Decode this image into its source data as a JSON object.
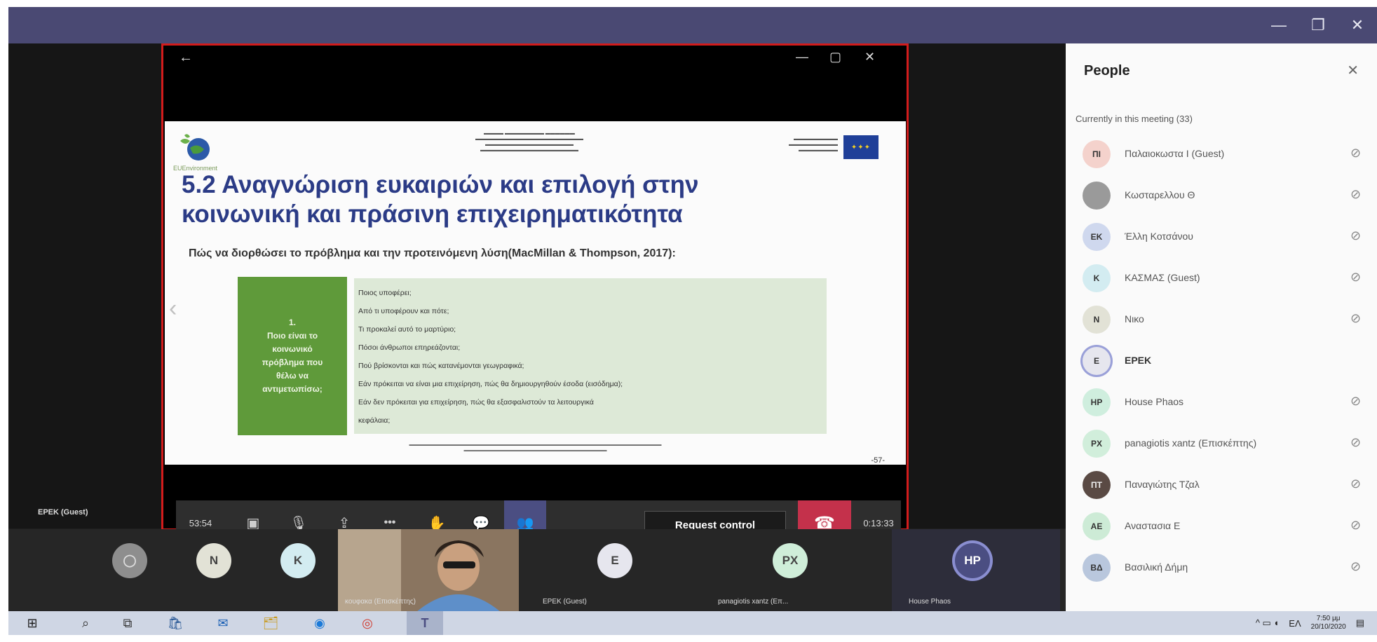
{
  "window": {
    "controls": {
      "minimize": "—",
      "restore": "❐",
      "close": "✕"
    }
  },
  "share": {
    "back_glyph": "←",
    "minimize_glyph": "—",
    "restore_glyph": "▢",
    "close_glyph": "✕",
    "prev_glyph": "‹"
  },
  "slide": {
    "logo_caption": "EUEnvironment",
    "title": "5.2 Αναγνώριση ευκαιριών και επιλογή στην κοινωνική και πράσινη επιχειρηματικότητα",
    "subtitle": "Πώς να διορθώσει το πρόβλημα και την προτεινόμενη λύση(MacMillan & Thompson, 2017):",
    "green_box": {
      "num": "1.",
      "lines": [
        "Ποιο είναι το",
        "κοινωνικό",
        "πρόβλημα που",
        "θέλω να",
        "αντιμετωπίσω;"
      ]
    },
    "questions": [
      "Ποιος υποφέρει;",
      "Από τι υποφέρουν και πότε;",
      "Τι προκαλεί αυτό το μαρτύριο;",
      "Πόσοι άνθρωποι επηρεάζονται;",
      "Πού βρίσκονται και πώς κατανέμονται γεωγραφικά;",
      "Εάν πρόκειται να είναι μια επιχείρηση, πώς θα δημιουργηθούν έσοδα (εισόδημα);",
      "Εάν δεν πρόκειται για επιχείρηση, πώς θα εξασφαλιστούν τα λειτουργικά",
      "κεφάλαια;"
    ],
    "page_number": "-57-"
  },
  "controls": {
    "time": "53:54",
    "camera_icon": "▣",
    "mic_icon": "🎙",
    "share_icon": "⇪",
    "more_icon": "•••",
    "hand_icon": "✋",
    "chat_icon": "💬",
    "people_icon": "👥",
    "request_control": "Request control",
    "hangup_icon": "☎",
    "elapsed": "0:13:33"
  },
  "stage_label": "EPEK (Guest)",
  "strip": {
    "tiles": [
      {
        "initials": "",
        "name": ""
      },
      {
        "initials": "N",
        "name": ""
      },
      {
        "initials": "K",
        "name": ""
      },
      {
        "initials": "",
        "name": "κουφακα (Επισκέπτης)"
      },
      {
        "initials": "E",
        "name": "EPEK (Guest)"
      },
      {
        "initials": "PX",
        "name": "panagiotis xantz (Επ..."
      },
      {
        "initials": "HP",
        "name": "House Phaos"
      }
    ]
  },
  "people": {
    "title": "People",
    "close": "✕",
    "section": "Currently in this meeting (33)",
    "members": [
      {
        "initials": "ΠΙ",
        "name": "Παλαιοκωστα Ι (Guest)",
        "color": "#f4d2cc"
      },
      {
        "initials": "",
        "name": "Κωσταρελλου Θ",
        "color": "#9a9a9a"
      },
      {
        "initials": "ΕΚ",
        "name": "Έλλη Κοτσάνου",
        "color": "#cfd8ee"
      },
      {
        "initials": "K",
        "name": "ΚΑΣΜΑΣ (Guest)",
        "color": "#d3ecf1"
      },
      {
        "initials": "N",
        "name": "Νικο",
        "color": "#e2e2d6"
      },
      {
        "initials": "E",
        "name": "EPEK",
        "color": "#e6e6ee"
      },
      {
        "initials": "HP",
        "name": "House Phaos",
        "color": "#cfeede"
      },
      {
        "initials": "PX",
        "name": "panagiotis xantz (Επισκέπτης)",
        "color": "#d1eedb"
      },
      {
        "initials": "ΠΤ",
        "name": "Παναγιώτης Τζαλ",
        "color": "#5a4a44"
      },
      {
        "initials": "ΑΕ",
        "name": "Αναστασια Ε",
        "color": "#cdebd6"
      },
      {
        "initials": "ΒΔ",
        "name": "Βασιλική Δήμη",
        "color": "#b9c7dd"
      }
    ]
  },
  "taskbar": {
    "icons": [
      "⊞",
      "⌕",
      "⧉",
      "🛍",
      "✉",
      "🗂",
      "◉",
      "◎",
      "T"
    ],
    "tray_icons": "^ ▭ ◖",
    "lang": "ΕΛ",
    "time": "7:50 μμ",
    "date": "20/10/2020",
    "notif": "▤"
  }
}
